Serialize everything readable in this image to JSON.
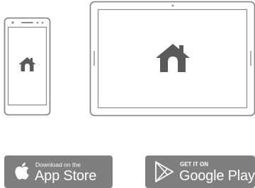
{
  "colors": {
    "device_outline": "#8a8a8a",
    "home_icon": "#5a5a5a",
    "badge_background": "#7f7f7f",
    "badge_text": "#ffffff"
  },
  "devices": {
    "phone": {
      "icon": "home-icon"
    },
    "tablet": {
      "icon": "home-icon"
    }
  },
  "badges": {
    "app_store": {
      "icon": "apple-logo-icon",
      "line1": "Download on the",
      "line2": "App Store"
    },
    "google_play": {
      "icon": "google-play-logo-icon",
      "line1": "GET IT ON",
      "line2": "Google Play"
    }
  }
}
